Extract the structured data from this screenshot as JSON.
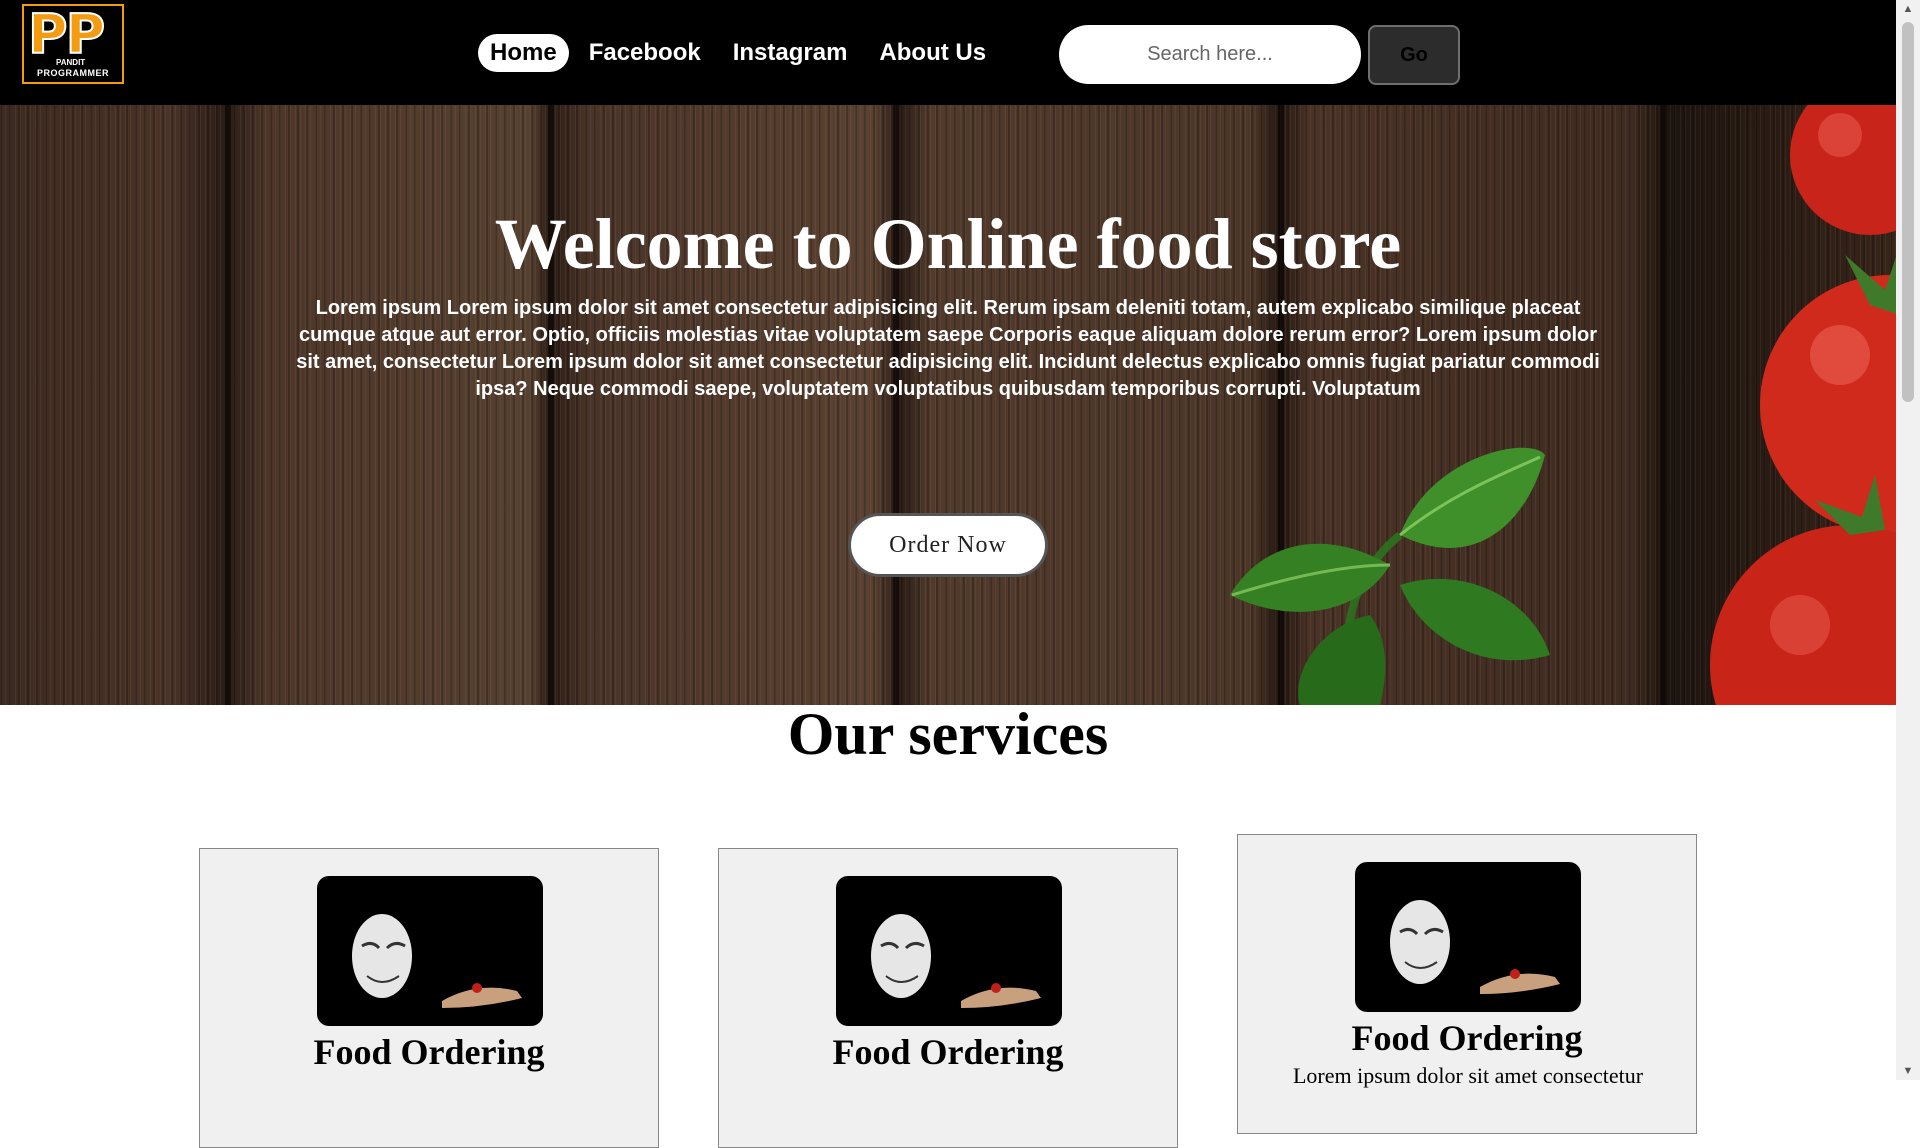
{
  "logo": {
    "letters": "PP",
    "subtitle_top": "PANDIT",
    "subtitle_bottom": "PROGRAMMER"
  },
  "nav": {
    "links": [
      {
        "label": "Home",
        "active": true
      },
      {
        "label": "Facebook",
        "active": false
      },
      {
        "label": "Instagram",
        "active": false
      },
      {
        "label": "About Us",
        "active": false
      }
    ]
  },
  "search": {
    "placeholder": "Search here...",
    "value": "",
    "button_label": "Go"
  },
  "hero": {
    "title": "Welcome to Online food store",
    "text": "Lorem ipsum Lorem ipsum dolor sit amet consectetur adipisicing elit. Rerum ipsam deleniti totam, autem explicabo similique placeat cumque atque aut error. Optio, officiis molestias vitae voluptatem saepe Corporis eaque aliquam dolore rerum error? Lorem ipsum dolor sit amet, consectetur Lorem ipsum dolor sit amet consectetur adipisicing elit. Incidunt delectus explicabo omnis fugiat pariatur commodi ipsa? Neque commodi saepe, voluptatem voluptatibus quibusdam temporibus corrupti. Voluptatum",
    "button_label": "Order Now"
  },
  "services": {
    "title": "Our services",
    "cards": [
      {
        "title": "Food Ordering",
        "text": ""
      },
      {
        "title": "Food Ordering",
        "text": ""
      },
      {
        "title": "Food Ordering",
        "text": "Lorem ipsum dolor sit amet consectetur"
      }
    ]
  },
  "colors": {
    "logo_accent": "#f39c12",
    "navbar_bg": "#000000",
    "card_bg": "#f0f0f0"
  },
  "icons": {
    "card_image": "mask-hand-image-icon",
    "logo": "pp-logo-icon"
  }
}
